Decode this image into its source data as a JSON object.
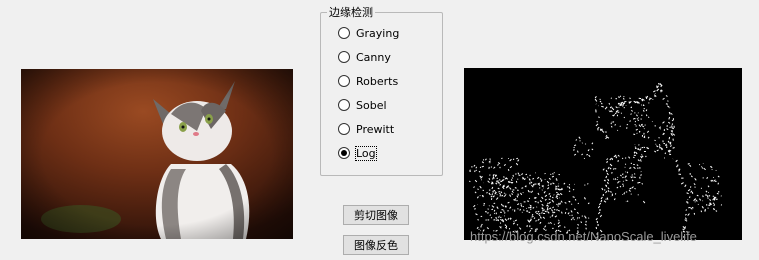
{
  "groupbox": {
    "title": "边缘检测",
    "options": [
      {
        "label": "Graying",
        "checked": false
      },
      {
        "label": "Canny",
        "checked": false
      },
      {
        "label": "Roberts",
        "checked": false
      },
      {
        "label": "Sobel",
        "checked": false
      },
      {
        "label": "Prewitt",
        "checked": false
      },
      {
        "label": "Log",
        "checked": true
      }
    ]
  },
  "buttons": {
    "crop_label": "剪切图像",
    "invert_label": "图像反色"
  },
  "watermark": "https://blog.csdn.net/NanoScale_livelife"
}
